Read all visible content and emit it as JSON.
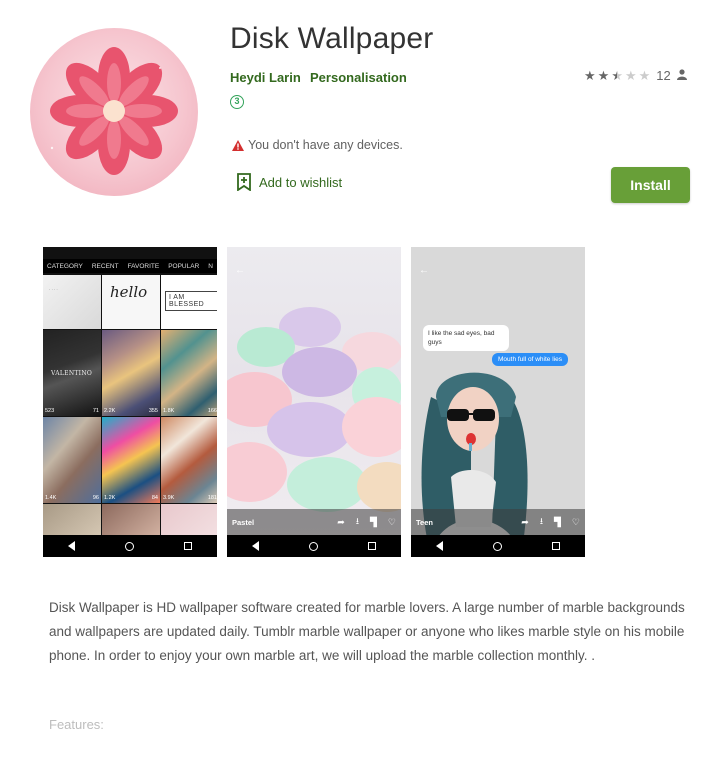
{
  "app": {
    "title": "Disk Wallpaper",
    "developer": "Heydi Larin",
    "category": "Personalisation",
    "age_rating": "3",
    "rating_stars": 2.5,
    "rating_count": "12",
    "device_warning": "You don't have any devices.",
    "wishlist_label": "Add to wishlist",
    "install_label": "Install"
  },
  "colors": {
    "accent_green": "#33691e",
    "install_button": "#689f38",
    "warning_red": "#d32f2f"
  },
  "screenshots": {
    "shot1": {
      "tabs": [
        "CATEGORY",
        "RECENT",
        "FAVORITE",
        "POPULAR",
        "N"
      ],
      "tiles": [
        {
          "overlay": "hello",
          "views": "",
          "downloads": "",
          "likes": ""
        },
        {
          "overlay": "I AM BLESSED",
          "views": "",
          "downloads": "",
          "likes": ""
        },
        {
          "overlay": "VALENTINO",
          "views": "523",
          "downloads": "71",
          "likes": ""
        },
        {
          "overlay": "",
          "views": "",
          "downloads": "2.2K",
          "likes": "355"
        },
        {
          "overlay": "",
          "views": "1.8K",
          "downloads": "",
          "likes": "166"
        },
        {
          "overlay": "",
          "views": "1.4K",
          "downloads": "96",
          "likes": ""
        },
        {
          "overlay": "",
          "views": "",
          "downloads": "1.2K",
          "likes": "84"
        },
        {
          "overlay": "",
          "views": "",
          "downloads": "3.9K",
          "likes": "181"
        }
      ]
    },
    "shot2": {
      "label": "Pastel"
    },
    "shot3": {
      "label": "Teen",
      "bubble_left": "I like the sad eyes, bad guys",
      "bubble_right": "Mouth full of white lies"
    }
  },
  "description": {
    "body": "Disk Wallpaper is HD wallpaper software created for marble lovers. A large number of marble backgrounds and wallpapers are updated daily. Tumblr marble wallpaper or anyone who likes marble style on his mobile phone. In order to enjoy your own marble art, we will upload the marble collection monthly. .",
    "features_heading": "Features:"
  },
  "icons": [
    "flower-logo-icon",
    "star-icon",
    "person-icon",
    "warning-icon",
    "bookmark-add-icon",
    "share-icon",
    "download-icon",
    "paint-roller-icon",
    "heart-icon",
    "back-arrow-icon",
    "nav-back-icon",
    "nav-home-icon",
    "nav-recents-icon"
  ]
}
